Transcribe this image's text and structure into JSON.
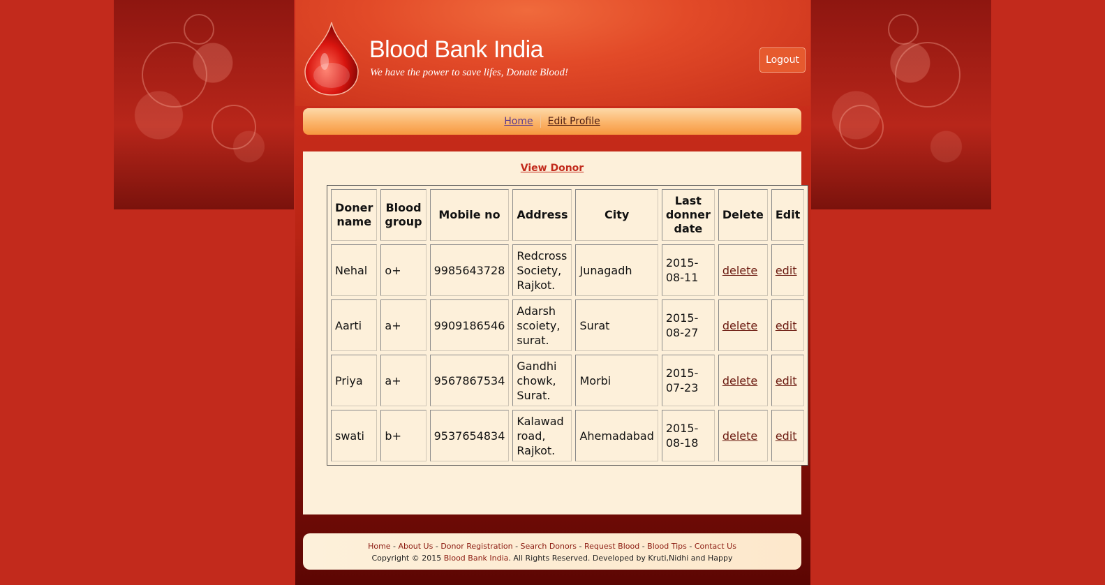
{
  "header": {
    "title": "Blood Bank India",
    "tagline": "We have the power to save lifes, Donate Blood!",
    "logout_label": "Logout"
  },
  "nav": {
    "items": [
      {
        "label": "Home"
      },
      {
        "label": "Edit Profile"
      }
    ]
  },
  "main": {
    "heading": "View Donor",
    "table": {
      "columns": [
        "Doner name",
        "Blood group",
        "Mobile no",
        "Address",
        "City",
        "Last donner date",
        "Delete",
        "Edit"
      ],
      "rows": [
        {
          "name": "Nehal",
          "group": "o+",
          "mobile": "9985643728",
          "address": "Redcross Society, Rajkot.",
          "city": "Junagadh",
          "date": "2015-08-11",
          "delete": "delete",
          "edit": "edit"
        },
        {
          "name": "Aarti",
          "group": "a+",
          "mobile": "9909186546",
          "address": "Adarsh scoiety, surat.",
          "city": "Surat",
          "date": "2015-08-27",
          "delete": "delete",
          "edit": "edit"
        },
        {
          "name": "Priya",
          "group": "a+",
          "mobile": "9567867534",
          "address": "Gandhi chowk, Surat.",
          "city": "Morbi",
          "date": "2015-07-23",
          "delete": "delete",
          "edit": "edit"
        },
        {
          "name": "swati",
          "group": "b+",
          "mobile": "9537654834",
          "address": "Kalawad road, Rajkot.",
          "city": "Ahemadabad",
          "date": "2015-08-18",
          "delete": "delete",
          "edit": "edit"
        }
      ]
    }
  },
  "footer": {
    "links": [
      "Home",
      "About Us",
      "Donor Registration",
      "Search Donors",
      "Request Blood",
      "Blood Tips",
      "Contact Us"
    ],
    "separator": " - ",
    "copy_prefix": "Copyright © 2015 ",
    "copy_brand": "Blood Bank India",
    "copy_suffix": ". All Rights Reserved. Developed by Kruti,Nidhi and Happy"
  },
  "colors": {
    "background": "#c22a1c",
    "nav": "#f7983f",
    "content": "#fdf0da",
    "link": "#6b1a10",
    "heading": "#c22a1c"
  },
  "icons": {
    "logo": "blood-drop-icon"
  }
}
